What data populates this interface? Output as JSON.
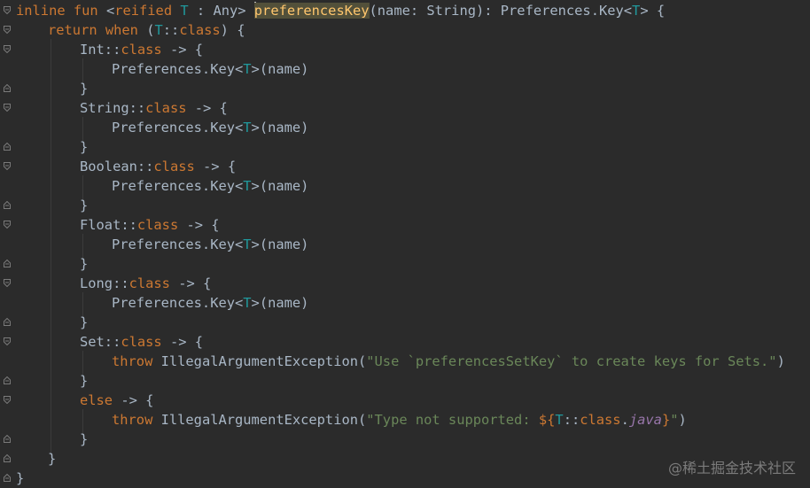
{
  "code": {
    "l1": {
      "kw1": "inline fun",
      "tp_open": " <",
      "kw2": "reified",
      "tp_T": " T",
      "rest1": " : Any> ",
      "fn": "preferencesKey",
      "rest2": "(name: String): Preferences.Key<",
      "tp_T2": "T",
      "rest3": "> {"
    },
    "l2": {
      "kw": "return when",
      "rest1": " (",
      "tp": "T",
      "rest2": "::",
      "kw2": "class",
      "rest3": ") {"
    },
    "l3": {
      "t": "Int::",
      "kw": "class",
      "r": " -> {"
    },
    "l4": {
      "t": "Preferences.Key<",
      "tp": "T",
      "r": ">(name)"
    },
    "l5": {
      "t": "}"
    },
    "l6": {
      "t": "String::",
      "kw": "class",
      "r": " -> {"
    },
    "l7": {
      "t": "Preferences.Key<",
      "tp": "T",
      "r": ">(name)"
    },
    "l8": {
      "t": "}"
    },
    "l9": {
      "t": "Boolean::",
      "kw": "class",
      "r": " -> {"
    },
    "l10": {
      "t": "Preferences.Key<",
      "tp": "T",
      "r": ">(name)"
    },
    "l11": {
      "t": "}"
    },
    "l12": {
      "t": "Float::",
      "kw": "class",
      "r": " -> {"
    },
    "l13": {
      "t": "Preferences.Key<",
      "tp": "T",
      "r": ">(name)"
    },
    "l14": {
      "t": "}"
    },
    "l15": {
      "t": "Long::",
      "kw": "class",
      "r": " -> {"
    },
    "l16": {
      "t": "Preferences.Key<",
      "tp": "T",
      "r": ">(name)"
    },
    "l17": {
      "t": "}"
    },
    "l18": {
      "t": "Set::",
      "kw": "class",
      "r": " -> {"
    },
    "l19": {
      "kw": "throw",
      "t": " IllegalArgumentException(",
      "str": "\"Use `preferencesSetKey` to create keys for Sets.\"",
      "r": ")"
    },
    "l20": {
      "t": "}"
    },
    "l21": {
      "kw": "else",
      "r": " -> {"
    },
    "l22": {
      "kw": "throw",
      "t": " IllegalArgumentException(",
      "str1": "\"Type not supported: ",
      "kw2": "${",
      "tp": "T",
      "t2": "::",
      "kw3": "class",
      "t3": ".",
      "ital": "java",
      "kw4": "}",
      "str2": "\"",
      "r": ")"
    },
    "l23": {
      "t": "}"
    },
    "l24": {
      "t": "}"
    },
    "l25": {
      "t": "}"
    }
  },
  "watermark": "@稀土掘金技术社区",
  "colors": {
    "background": "#2b2b2b",
    "keyword": "#cc7832",
    "type_param": "#20999d",
    "string": "#6a8759",
    "function": "#ffc66d",
    "default": "#a9b7c6"
  }
}
